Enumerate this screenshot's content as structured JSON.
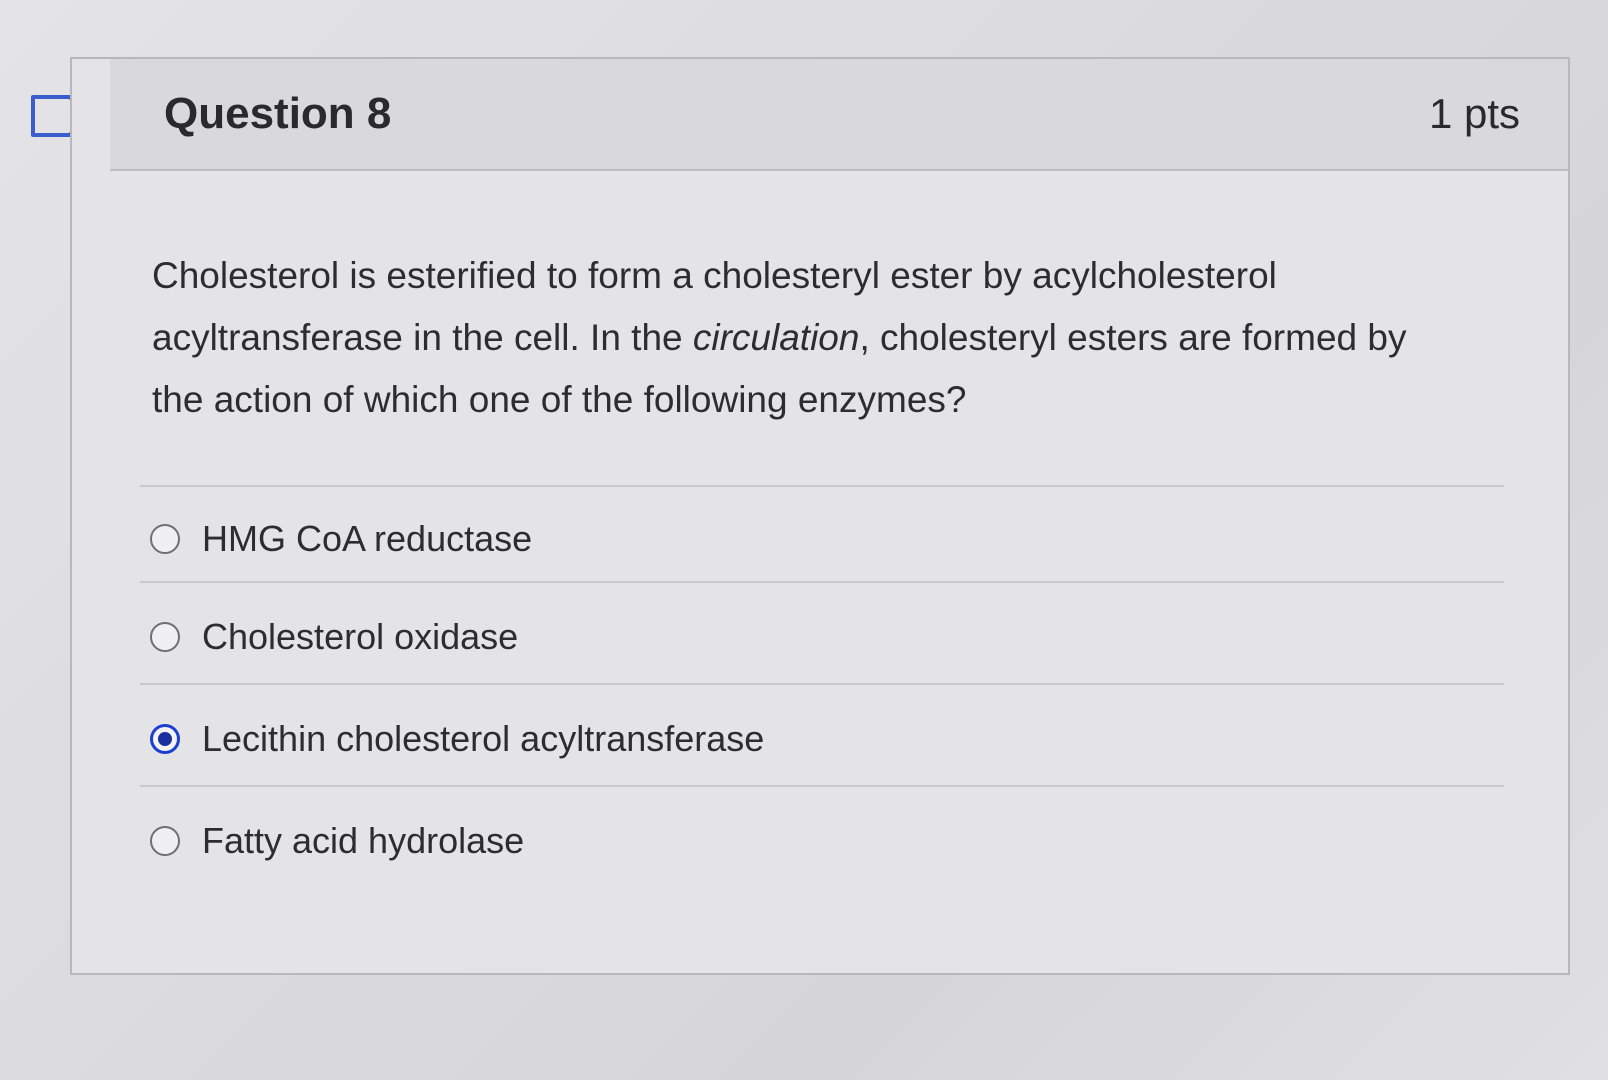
{
  "question": {
    "title": "Question 8",
    "points": "1 pts",
    "text_part1": "Cholesterol is esterified to form a cholesteryl ester by acylcholesterol acyltransferase in the cell. In the ",
    "text_italic": "circulation",
    "text_part2": ", cholesteryl esters are formed by the action of which one of the following enzymes?"
  },
  "answers": [
    {
      "label": "HMG CoA reductase",
      "selected": false
    },
    {
      "label": "Cholesterol oxidase",
      "selected": false
    },
    {
      "label": "Lecithin cholesterol acyltransferase",
      "selected": true
    },
    {
      "label": "Fatty acid hydrolase",
      "selected": false
    }
  ],
  "colors": {
    "selected_radio": "#1b3fd1",
    "flag_outline": "#3a5fcd"
  },
  "icons": {
    "flag": "bookmark-flag-icon"
  }
}
